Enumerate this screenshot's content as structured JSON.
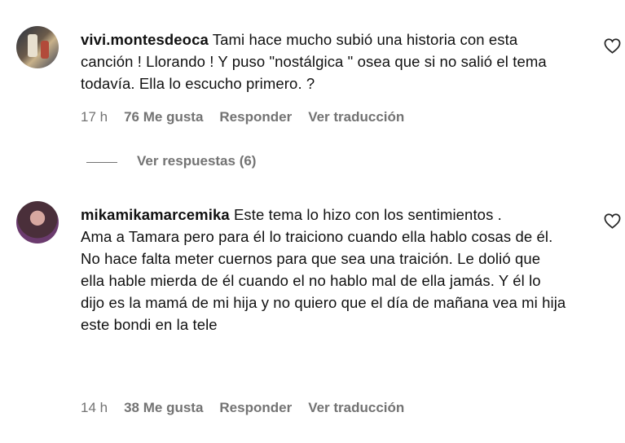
{
  "comments": [
    {
      "username": "vivi.montesdeoca",
      "text": "Tami hace mucho subió una historia con esta canción ! Llorando ! Y puso \"nostálgica \" osea que si no salió el tema todavía. Ella lo escucho primero. ?",
      "time": "17 h",
      "likes": "76 Me gusta",
      "reply": "Responder",
      "translate": "Ver traducción",
      "avatar_icon": "avatar-photo-icon",
      "heart_icon": "heart-outline-icon"
    },
    {
      "username": "mikamikamarcemika",
      "text_first": "Este tema lo hizo con los sentimientos .",
      "text_second": "Ama a Tamara pero para él lo traiciono cuando ella hablo cosas de él. No hace falta meter cuernos para que sea una traición. Le dolió que ella hable mierda de él cuando el no hablo mal de ella jamás. Y él lo dijo es la mamá de mi hija y no quiero que el día de mañana vea mi hija este bondi en la tele",
      "time": "14 h",
      "likes": "38 Me gusta",
      "reply": "Responder",
      "translate": "Ver traducción",
      "avatar_icon": "avatar-photo-icon",
      "heart_icon": "heart-outline-icon"
    }
  ],
  "view_replies": "Ver respuestas (6)"
}
